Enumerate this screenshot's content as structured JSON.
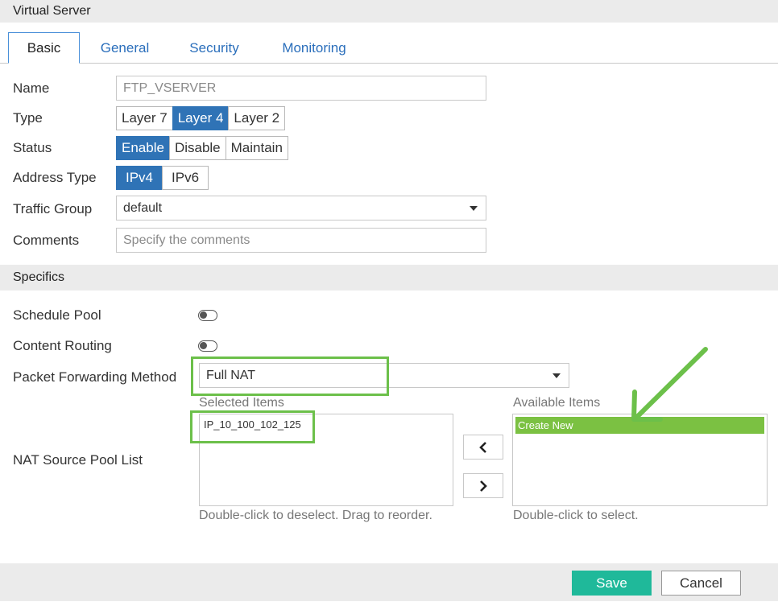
{
  "header": {
    "title": "Virtual Server"
  },
  "tabs": [
    {
      "label": "Basic",
      "active": true
    },
    {
      "label": "General",
      "active": false
    },
    {
      "label": "Security",
      "active": false
    },
    {
      "label": "Monitoring",
      "active": false
    }
  ],
  "form": {
    "name": {
      "label": "Name",
      "value": "FTP_VSERVER"
    },
    "type": {
      "label": "Type",
      "options": [
        "Layer 7",
        "Layer 4",
        "Layer 2"
      ],
      "selected": "Layer 4"
    },
    "status": {
      "label": "Status",
      "options": [
        "Enable",
        "Disable",
        "Maintain"
      ],
      "selected": "Enable"
    },
    "address_type": {
      "label": "Address Type",
      "options": [
        "IPv4",
        "IPv6"
      ],
      "selected": "IPv4"
    },
    "traffic_group": {
      "label": "Traffic Group",
      "value": "default"
    },
    "comments": {
      "label": "Comments",
      "placeholder": "Specify the comments"
    }
  },
  "specifics": {
    "title": "Specifics",
    "schedule_pool": {
      "label": "Schedule Pool",
      "enabled": false
    },
    "content_routing": {
      "label": "Content Routing",
      "enabled": false
    },
    "packet_forwarding": {
      "label": "Packet Forwarding Method",
      "value": "Full NAT"
    },
    "nat_source_pool": {
      "label": "NAT Source Pool List",
      "selected_title": "Selected Items",
      "selected_items": [
        "IP_10_100_102_125"
      ],
      "selected_hint": "Double-click to deselect. Drag to reorder.",
      "available_title": "Available Items",
      "available_items": [
        "Create New"
      ],
      "available_hint": "Double-click to select."
    }
  },
  "footer": {
    "save_label": "Save",
    "cancel_label": "Cancel"
  },
  "colors": {
    "accent": "#2f73b6",
    "save_button": "#1fb99a",
    "highlight": "#6cc04a",
    "available_selected": "#7bc142"
  },
  "icons": {
    "move_left": "chevron-left-icon",
    "move_right": "chevron-right-icon",
    "dropdown": "caret-down-icon",
    "annotation": "arrow-icon"
  }
}
